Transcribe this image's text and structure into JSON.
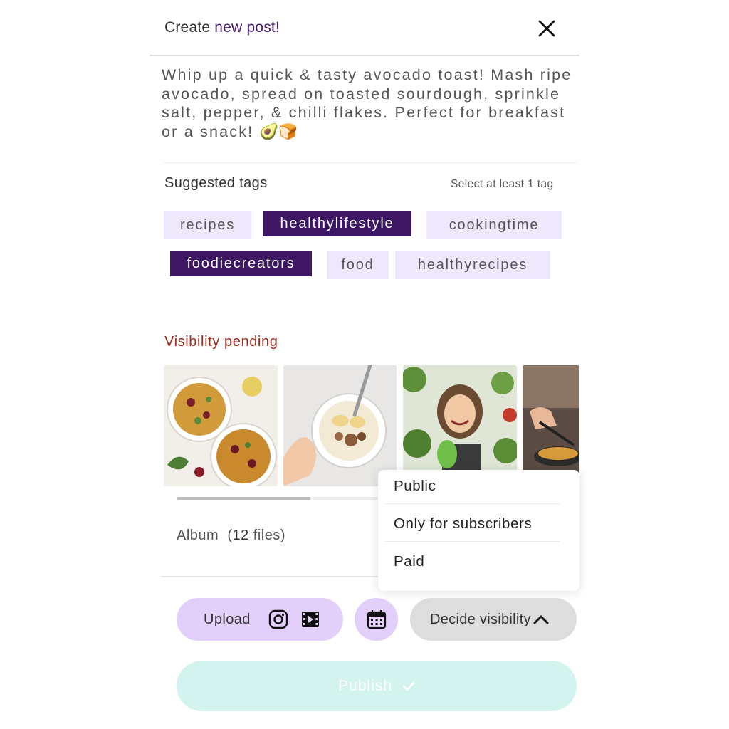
{
  "header": {
    "title_prefix": "Create",
    "title_accent": "new post!",
    "close_icon": "close-icon"
  },
  "caption": {
    "text": "Whip up a quick & tasty avocado toast! Mash ripe avocado, spread on toasted sourdough, sprinkle salt, pepper, & chilli flakes. Perfect for breakfast or a snack!",
    "emojis": "🥑🍞"
  },
  "tags": {
    "label": "Suggested tags",
    "hint": "Select at least 1 tag",
    "items": [
      {
        "label": "recipes",
        "selected": false
      },
      {
        "label": "healthylifestyle",
        "selected": true
      },
      {
        "label": "cookingtime",
        "selected": false
      },
      {
        "label": "foodiecreators",
        "selected": true
      },
      {
        "label": "food",
        "selected": false
      },
      {
        "label": "healthyrecipes",
        "selected": false
      }
    ]
  },
  "visibility": {
    "status": "Visibility pending",
    "options": [
      "Public",
      "Only for subscribers",
      "Paid"
    ]
  },
  "album": {
    "label": "Album",
    "count": "12",
    "files_open": "(",
    "files_close": " files)",
    "scroll_fraction": 0.33,
    "images": [
      "grain-salad-bowls",
      "yogurt-banana-bowl",
      "woman-with-vegetables",
      "cooking-in-pan"
    ]
  },
  "actions": {
    "upload_label": "Upload",
    "upload_icons": [
      "instagram-icon",
      "video-icon"
    ],
    "calendar_icon": "calendar-icon",
    "visibility_label": "Decide visibility",
    "visibility_icon": "chevron-up-icon",
    "publish_label": "Publish",
    "publish_icon": "check-icon"
  },
  "colors": {
    "accent": "#3d1763",
    "tag_bg": "#efe7fb",
    "button_lilac": "#e2cffa",
    "warning_text": "#9b2a1e",
    "publish_disabled": "#d3f4ee"
  }
}
